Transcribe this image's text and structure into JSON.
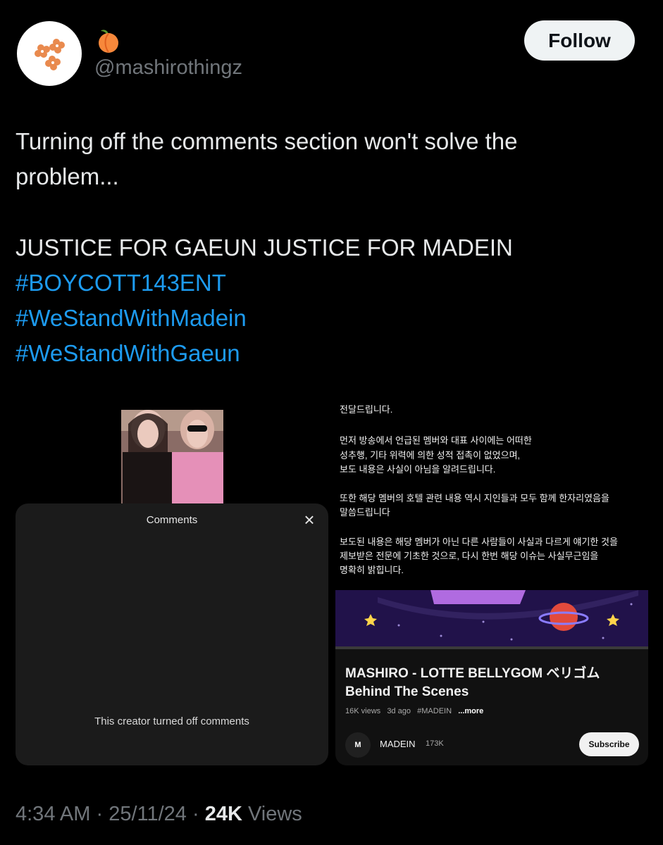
{
  "author": {
    "name_emoji": "🍑",
    "handle": "@mashirothingz"
  },
  "follow_label": "Follow",
  "tweet": {
    "line1": "Turning off the comments section won't solve the",
    "line2": "problem...",
    "line3": "JUSTICE FOR GAEUN JUSTICE FOR MADEIN",
    "hashtags": [
      "#BOYCOTT143ENT",
      "#WeStandWithMadein",
      "#WeStandWithGaeun"
    ]
  },
  "media_left": {
    "sheet_title": "Comments",
    "close_icon": "×",
    "message": "This creator turned off comments"
  },
  "media_right": {
    "korean_lines": [
      "전달드립니다.",
      "먼저 방송에서 언급된 멤버와 대표 사이에는 어떠한",
      "성추행, 기타 위력에 의한 성적 접촉이 없었으며,",
      "보도 내용은 사실이 아님을 알려드립니다.",
      "또한 해당 멤버의 호텔 관련 내용 역시 지인들과 모두 함께 한자리였음을",
      "말씀드립니다",
      "보도된 내용은 해당 멤버가 아닌 다른 사람들이 사실과 다르게 얘기한 것을",
      "제보받은 전문에 기초한 것으로, 다시 한번 해당 이슈는 사실무근임을",
      "명확히 밝힙니다."
    ],
    "video_title": "MASHIRO - LOTTE BELLYGOM ベリゴム Behind The Scenes",
    "views": "16K views",
    "age": "3d ago",
    "tag": "#MADEIN",
    "more": "...more",
    "channel_logo": "M",
    "channel": "MADEIN",
    "subs": "173K",
    "subscribe_label": "Subscribe"
  },
  "footer": {
    "time": "4:34 AM",
    "date": "25/11/24",
    "views_count": "24K",
    "views_label": "Views"
  },
  "colors": {
    "link": "#1d9bf0",
    "muted": "#71767b",
    "background": "#000000",
    "banner": "#21124a"
  }
}
